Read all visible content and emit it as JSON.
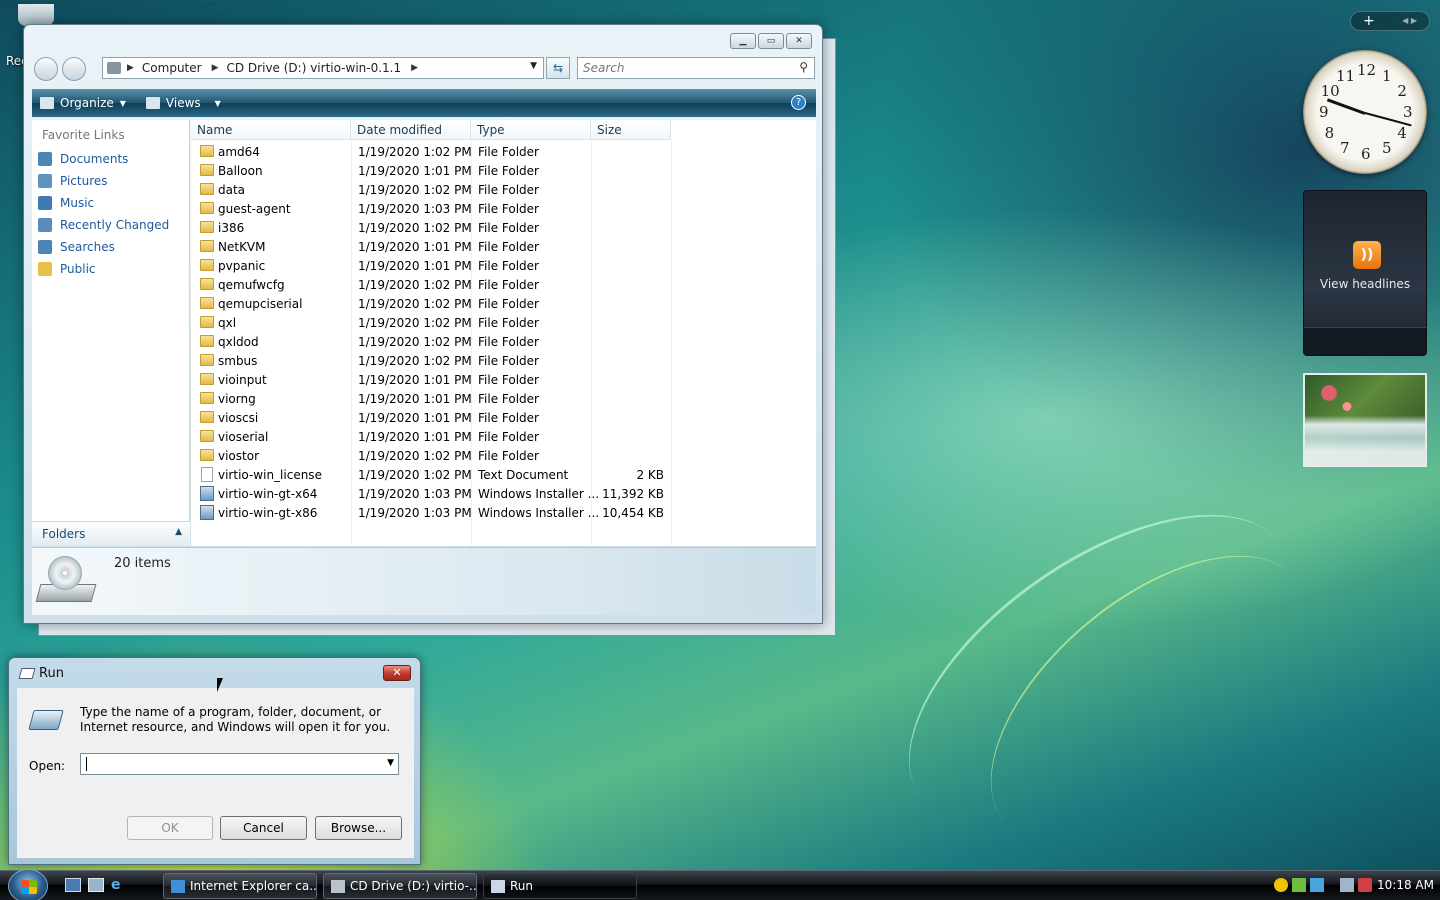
{
  "desktop": {
    "recycle_label": "Rec"
  },
  "explorer": {
    "breadcrumbs": [
      "Computer",
      "CD Drive (D:) virtio-win-0.1.1"
    ],
    "search_placeholder": "Search",
    "toolbar": {
      "organize": "Organize",
      "views": "Views"
    },
    "favorite_links_title": "Favorite Links",
    "favorite_links": [
      {
        "label": "Documents",
        "icon": "documents-icon"
      },
      {
        "label": "Pictures",
        "icon": "pictures-icon"
      },
      {
        "label": "Music",
        "icon": "music-icon"
      },
      {
        "label": "Recently Changed",
        "icon": "recently-changed-icon"
      },
      {
        "label": "Searches",
        "icon": "searches-icon"
      },
      {
        "label": "Public",
        "icon": "public-folder-icon"
      }
    ],
    "folders_label": "Folders",
    "columns": [
      "Name",
      "Date modified",
      "Type",
      "Size"
    ],
    "files": [
      {
        "name": "amd64",
        "date": "1/19/2020 1:02 PM",
        "type": "File Folder",
        "size": "",
        "kind": "folder"
      },
      {
        "name": "Balloon",
        "date": "1/19/2020 1:01 PM",
        "type": "File Folder",
        "size": "",
        "kind": "folder"
      },
      {
        "name": "data",
        "date": "1/19/2020 1:02 PM",
        "type": "File Folder",
        "size": "",
        "kind": "folder"
      },
      {
        "name": "guest-agent",
        "date": "1/19/2020 1:03 PM",
        "type": "File Folder",
        "size": "",
        "kind": "folder"
      },
      {
        "name": "i386",
        "date": "1/19/2020 1:02 PM",
        "type": "File Folder",
        "size": "",
        "kind": "folder"
      },
      {
        "name": "NetKVM",
        "date": "1/19/2020 1:01 PM",
        "type": "File Folder",
        "size": "",
        "kind": "folder"
      },
      {
        "name": "pvpanic",
        "date": "1/19/2020 1:01 PM",
        "type": "File Folder",
        "size": "",
        "kind": "folder"
      },
      {
        "name": "qemufwcfg",
        "date": "1/19/2020 1:02 PM",
        "type": "File Folder",
        "size": "",
        "kind": "folder"
      },
      {
        "name": "qemupciserial",
        "date": "1/19/2020 1:02 PM",
        "type": "File Folder",
        "size": "",
        "kind": "folder"
      },
      {
        "name": "qxl",
        "date": "1/19/2020 1:02 PM",
        "type": "File Folder",
        "size": "",
        "kind": "folder"
      },
      {
        "name": "qxldod",
        "date": "1/19/2020 1:02 PM",
        "type": "File Folder",
        "size": "",
        "kind": "folder"
      },
      {
        "name": "smbus",
        "date": "1/19/2020 1:02 PM",
        "type": "File Folder",
        "size": "",
        "kind": "folder"
      },
      {
        "name": "vioinput",
        "date": "1/19/2020 1:01 PM",
        "type": "File Folder",
        "size": "",
        "kind": "folder"
      },
      {
        "name": "viorng",
        "date": "1/19/2020 1:01 PM",
        "type": "File Folder",
        "size": "",
        "kind": "folder"
      },
      {
        "name": "vioscsi",
        "date": "1/19/2020 1:01 PM",
        "type": "File Folder",
        "size": "",
        "kind": "folder"
      },
      {
        "name": "vioserial",
        "date": "1/19/2020 1:01 PM",
        "type": "File Folder",
        "size": "",
        "kind": "folder"
      },
      {
        "name": "viostor",
        "date": "1/19/2020 1:02 PM",
        "type": "File Folder",
        "size": "",
        "kind": "folder"
      },
      {
        "name": "virtio-win_license",
        "date": "1/19/2020 1:02 PM",
        "type": "Text Document",
        "size": "2 KB",
        "kind": "text"
      },
      {
        "name": "virtio-win-gt-x64",
        "date": "1/19/2020 1:03 PM",
        "type": "Windows Installer ...",
        "size": "11,392 KB",
        "kind": "msi"
      },
      {
        "name": "virtio-win-gt-x86",
        "date": "1/19/2020 1:03 PM",
        "type": "Windows Installer ...",
        "size": "10,454 KB",
        "kind": "msi"
      }
    ],
    "status": "20 items"
  },
  "run_dialog": {
    "title": "Run",
    "description": "Type the name of a program, folder, document, or Internet resource, and Windows will open it for you.",
    "open_label": "Open:",
    "open_value": "",
    "ok": "OK",
    "cancel": "Cancel",
    "browse": "Browse..."
  },
  "gadgets": {
    "add": "+",
    "clock_numbers": [
      "12",
      "1",
      "2",
      "3",
      "4",
      "5",
      "6",
      "7",
      "8",
      "9",
      "10",
      "11"
    ],
    "feed_label": "View headlines"
  },
  "taskbar": {
    "tasks": [
      {
        "label": "Internet Explorer ca...",
        "icon": "ie-icon"
      },
      {
        "label": "CD Drive (D:) virtio-...",
        "icon": "cd-drive-icon"
      },
      {
        "label": "Run",
        "icon": "run-icon"
      }
    ],
    "time": "10:18 AM"
  }
}
